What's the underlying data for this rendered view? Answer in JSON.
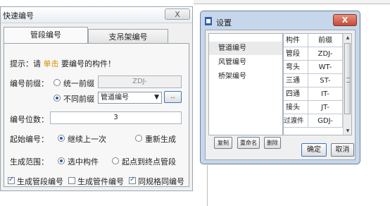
{
  "quick": {
    "title": "快速编号",
    "close_label": "X",
    "tabs": [
      "管段编号",
      "支吊架编号"
    ],
    "hint_prefix": "提示：请",
    "hint_highlight": "单击",
    "hint_suffix": "要编号的构件！",
    "prefix_label": "编号前缀：",
    "uniform_prefix_label": "统一前缀",
    "uniform_prefix_value": "ZDJ-",
    "different_prefix_label": "不同前缀",
    "prefix_type_selected": "管道编号",
    "browse_label": "..",
    "digits_label": "编号位数：",
    "digits_value": "3",
    "start_label": "起始编号：",
    "continue_label": "继续上一次",
    "regenerate_label": "重新生成",
    "range_label": "生成范围：",
    "selected_parts_label": "选中构件",
    "start_end_label": "起点到终点管段",
    "gen_pipe_label": "生成管段编号",
    "gen_fitting_label": "生成管件编号",
    "same_spec_label": "同规格同编号",
    "options": {
      "prefix_mode": "different",
      "start_mode": "continue",
      "range_mode": "selected",
      "gen_pipe": true,
      "gen_fitting": false,
      "same_spec": true
    }
  },
  "settings": {
    "title": "设置",
    "close_label": "X",
    "categories": [
      "管道编号",
      "风管编号",
      "桥架编号"
    ],
    "selected_category": "管道编号",
    "columns": [
      "构件",
      "前缀"
    ],
    "rows": [
      [
        "管段",
        "ZDJ-"
      ],
      [
        "弯头",
        "WT-"
      ],
      [
        "三通",
        "ST-"
      ],
      [
        "四通",
        "IT-"
      ],
      [
        "接头",
        "JT-"
      ],
      [
        "过渡件",
        "GDJ-"
      ]
    ],
    "copy_label": "复制",
    "rename_label": "重命名",
    "delete_label": "删除",
    "ok_label": "确定",
    "cancel_label": "取消"
  }
}
